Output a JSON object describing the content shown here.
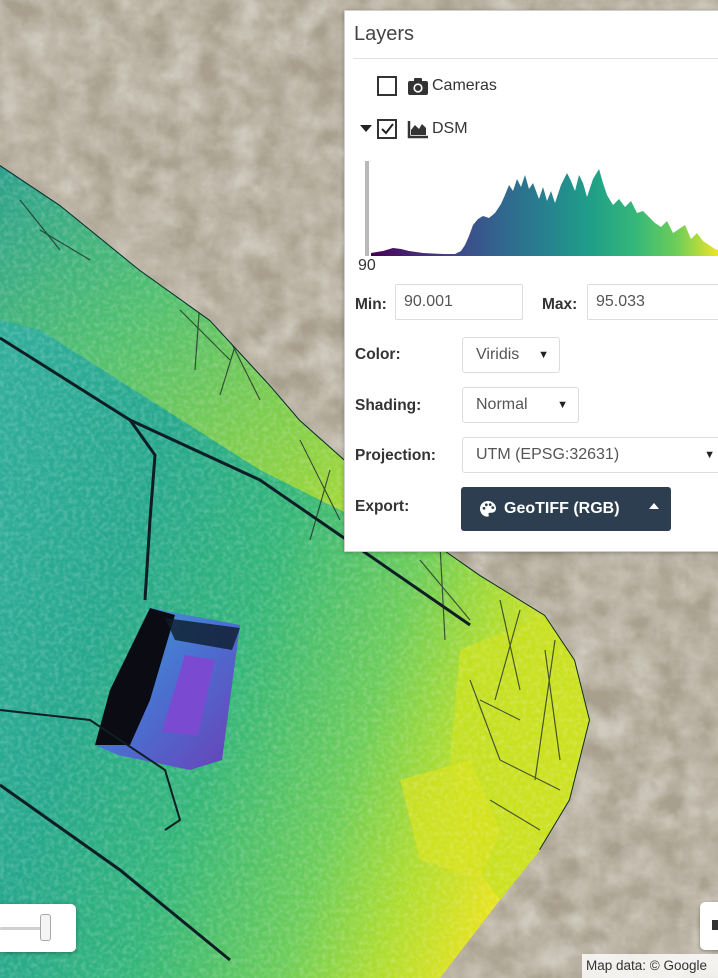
{
  "panel": {
    "title": "Layers",
    "layers": [
      {
        "label": "Cameras",
        "checked": false,
        "expanded": null,
        "icon": "camera-icon"
      },
      {
        "label": "DSM",
        "checked": true,
        "expanded": true,
        "icon": "area-chart-icon"
      }
    ],
    "histogram": {
      "min_label": "90",
      "colormap": "viridis"
    },
    "min": {
      "label": "Min:",
      "value": "90.001"
    },
    "max": {
      "label": "Max:",
      "value": "95.033"
    },
    "color": {
      "label": "Color:",
      "value": "Viridis"
    },
    "shading": {
      "label": "Shading:",
      "value": "Normal"
    },
    "projection": {
      "label": "Projection:",
      "value": "UTM (EPSG:32631)"
    },
    "export": {
      "label": "Export:",
      "button": "GeoTIFF (RGB)"
    }
  },
  "map": {
    "attribution": "Map data: © Google"
  },
  "colors": {
    "export_button": "#2c3e50",
    "satellite_ground": "#a89f8d",
    "viridis_low": "#440154",
    "viridis_mid": "#21918c",
    "viridis_high": "#fde725"
  }
}
